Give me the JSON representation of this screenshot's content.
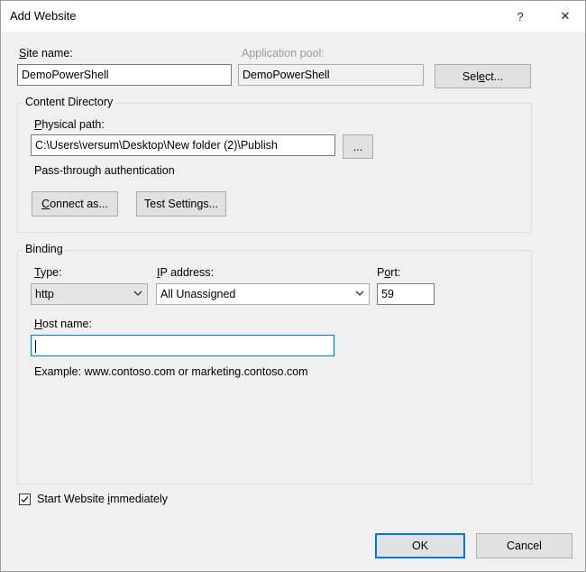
{
  "window": {
    "title": "Add Website",
    "help_glyph": "?",
    "close_glyph": "✕"
  },
  "site": {
    "site_name_label_ul": "S",
    "site_name_label_rest": "ite name:",
    "site_name_value": "DemoPowerShell",
    "app_pool_label": "Application pool:",
    "app_pool_value": "DemoPowerShell",
    "select_button_pre": "Sel",
    "select_button_ul": "e",
    "select_button_post": "ct..."
  },
  "content_directory": {
    "group_title": "Content Directory",
    "physical_path_label_ul": "P",
    "physical_path_label_rest": "hysical path:",
    "physical_path_value": "C:\\Users\\versum\\Desktop\\New folder (2)\\Publish",
    "browse_button": "...",
    "pass_through": "Pass-through authentication",
    "connect_as_pre": "",
    "connect_as_ul": "C",
    "connect_as_post": "onnect as...",
    "test_settings_pre": "Test Settin",
    "test_settings_ul": "g",
    "test_settings_post": "s..."
  },
  "binding": {
    "group_title": "Binding",
    "type_label_ul": "T",
    "type_label_rest": "ype:",
    "type_value": "http",
    "ip_label_ul": "I",
    "ip_label_rest": "P address:",
    "ip_value": "All Unassigned",
    "port_label_pre": "P",
    "port_label_ul": "o",
    "port_label_post": "rt:",
    "port_value": "59",
    "host_label_ul": "H",
    "host_label_rest": "ost name:",
    "host_value": "",
    "example_text": "Example: www.contoso.com or marketing.contoso.com"
  },
  "start": {
    "checked": true,
    "label_pre": "Start Website ",
    "label_ul": "i",
    "label_post": "mmediately"
  },
  "footer": {
    "ok_label": "OK",
    "cancel_label": "Cancel"
  },
  "colors": {
    "accent": "#0078d7",
    "dialog_bg": "#f0f0f0"
  },
  "icons": {
    "type_dropdown": "chevron-down-icon",
    "ip_dropdown": "chevron-down-icon",
    "checkbox": "check-icon"
  }
}
